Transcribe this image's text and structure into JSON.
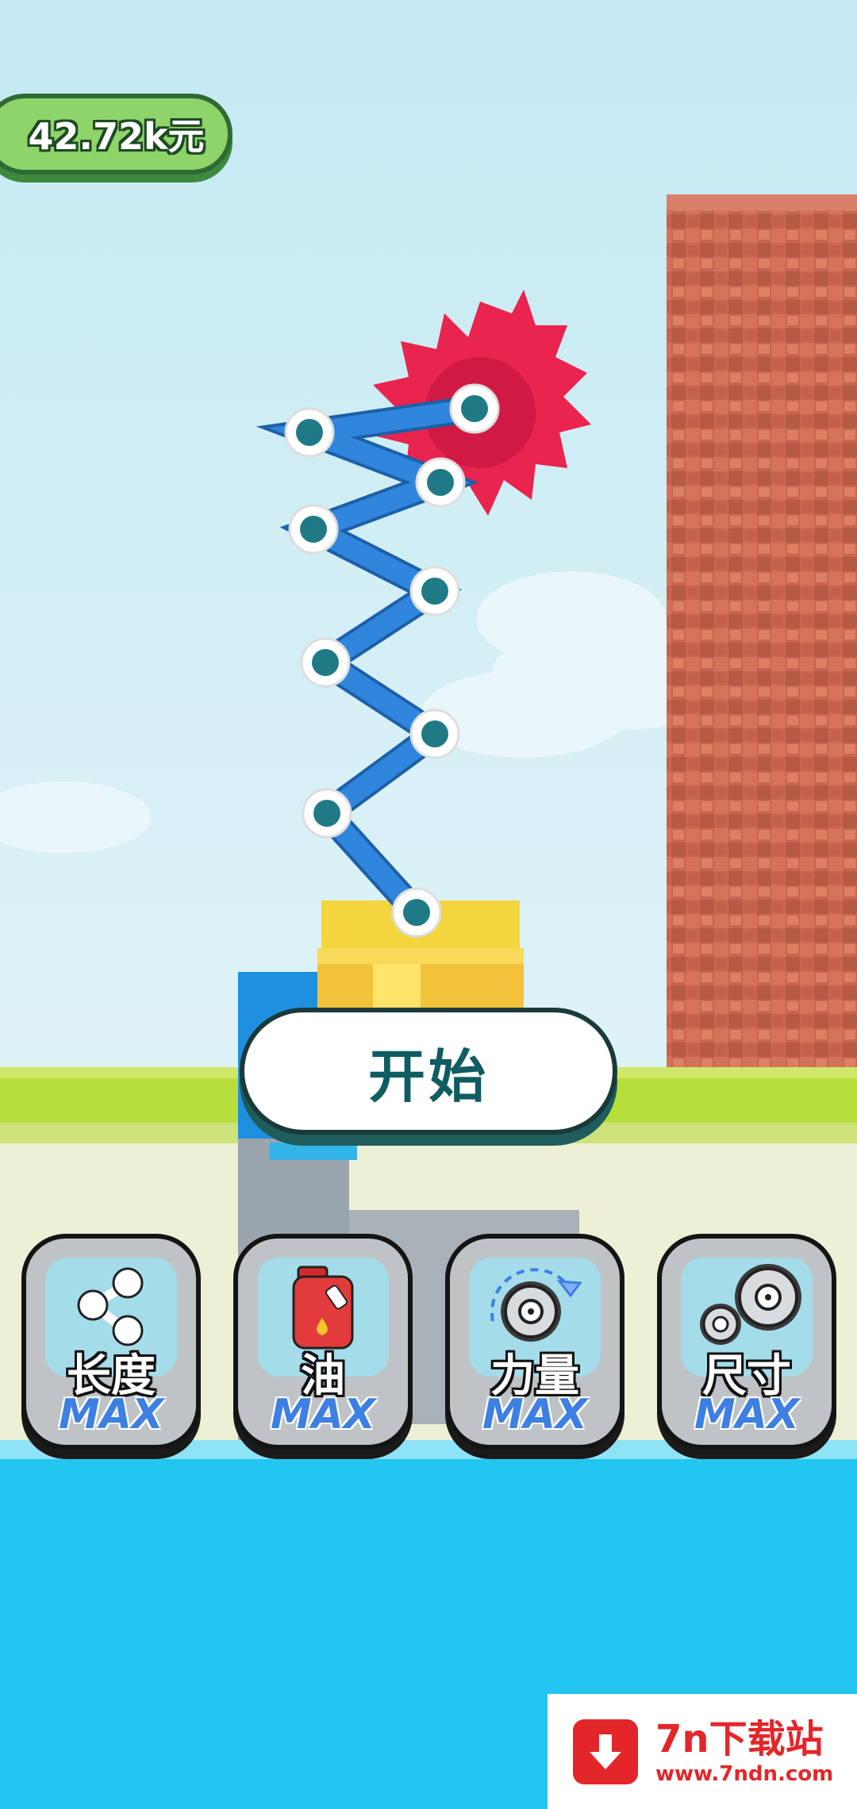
{
  "hud": {
    "money": "42.72k元"
  },
  "start_button": {
    "label": "开始"
  },
  "upgrades": [
    {
      "label": "长度",
      "level": "MAX",
      "icon": "share-link-icon"
    },
    {
      "label": "油",
      "level": "MAX",
      "icon": "fuel-can-icon"
    },
    {
      "label": "力量",
      "level": "MAX",
      "icon": "saw-power-icon"
    },
    {
      "label": "尺寸",
      "level": "MAX",
      "icon": "saw-size-icon"
    }
  ],
  "watermark": {
    "title": "7n下载站",
    "url": "www.7ndn.com"
  },
  "colors": {
    "saw": "#e8244f",
    "arm": "#2f86dc",
    "joint": "#1f7a86",
    "wall": "#c76a55",
    "water": "#22c6f0",
    "grass": "#b8de3c"
  }
}
